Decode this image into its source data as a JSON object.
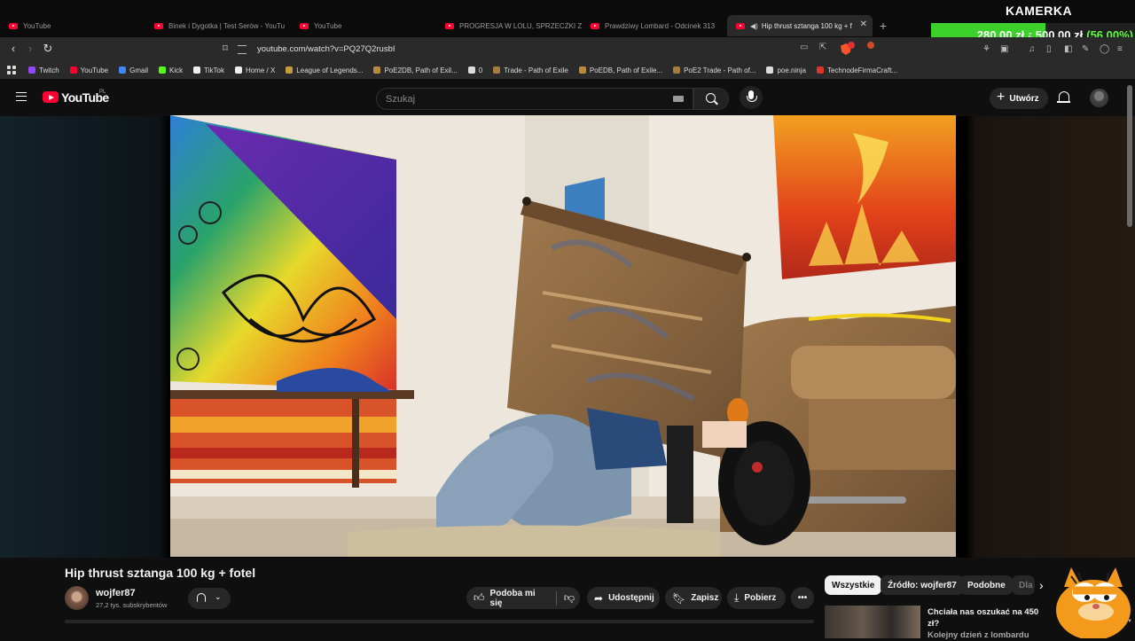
{
  "overlay": {
    "title": "KAMERKA",
    "goal_current": "280,00 zł",
    "goal_separator": "z",
    "goal_target": "500,00 zł",
    "goal_percent": "(56.00%)",
    "goal_fraction": 0.56,
    "colors": {
      "fill": "#3bd12a",
      "percent": "#61ff3b"
    }
  },
  "browser": {
    "tabs": [
      {
        "label": "YouTube",
        "icon": "youtube-icon",
        "active": false
      },
      {
        "label": "Binek i Dygotka | Test Serów - YouTu",
        "icon": "youtube-icon",
        "active": false
      },
      {
        "label": "YouTube",
        "icon": "youtube-icon",
        "active": false
      },
      {
        "label": "PROGRESJA W LOLU, SPRZECZKI Z R",
        "icon": "youtube-icon",
        "active": false
      },
      {
        "label": "Prawdziwy Lombard - Odcinek 313",
        "icon": "youtube-icon",
        "active": false
      },
      {
        "label": "Hip thrust sztanga 100 kg + f",
        "icon": "youtube-icon",
        "active": true
      }
    ],
    "url": "youtube.com/watch?v=PQ27Q2rusbI",
    "bookmarks": [
      {
        "label": "Twitch",
        "icon": "twitch-icon",
        "color": "#9146ff"
      },
      {
        "label": "YouTube",
        "icon": "youtube-icon",
        "color": "#ff0033"
      },
      {
        "label": "Gmail",
        "icon": "google-icon",
        "color": "#4285f4"
      },
      {
        "label": "Kick",
        "icon": "kick-icon",
        "color": "#53fc18"
      },
      {
        "label": "TikTok",
        "icon": "tiktok-icon",
        "color": "#eeeeee"
      },
      {
        "label": "Home / X",
        "icon": "x-icon",
        "color": "#eeeeee"
      },
      {
        "label": "League of Legends...",
        "icon": "lol-icon",
        "color": "#c89b3c"
      },
      {
        "label": "PoE2DB, Path of Exil...",
        "icon": "poedb-icon",
        "color": "#b88a3a"
      },
      {
        "label": "0",
        "icon": "folder-icon",
        "color": "#dcdcdc"
      },
      {
        "label": "Trade - Path of Exile",
        "icon": "poe-icon",
        "color": "#a67c3d"
      },
      {
        "label": "PoEDB, Path of Exile...",
        "icon": "poedb-icon",
        "color": "#b88a3a"
      },
      {
        "label": "PoE2 Trade - Path of...",
        "icon": "poe-icon",
        "color": "#a67c3d"
      },
      {
        "label": "poe.ninja",
        "icon": "ninja-icon",
        "color": "#dcdcdc"
      },
      {
        "label": "TechnodeFirmaCraft...",
        "icon": "technode-icon",
        "color": "#d9352b"
      }
    ]
  },
  "youtube": {
    "logo_text": "YouTube",
    "region": "PL",
    "search_placeholder": "Szukaj",
    "create_label": "Utwórz",
    "video": {
      "title": "Hip thrust sztanga 100 kg + fotel",
      "channel": "wojfer87",
      "subscribers": "27,2 tys. subskrybentów"
    },
    "actions": {
      "like": "Podoba mi się",
      "share": "Udostępnij",
      "save": "Zapisz",
      "download": "Pobierz"
    },
    "chips": [
      "Wszystkie",
      "Źródło: wojfer87",
      "Podobne",
      "Dla"
    ],
    "recommendation": {
      "title_line1": "Chciała nas oszukać na 450 zł?",
      "title_line2": "Kolejny dzień z lombardu"
    }
  }
}
